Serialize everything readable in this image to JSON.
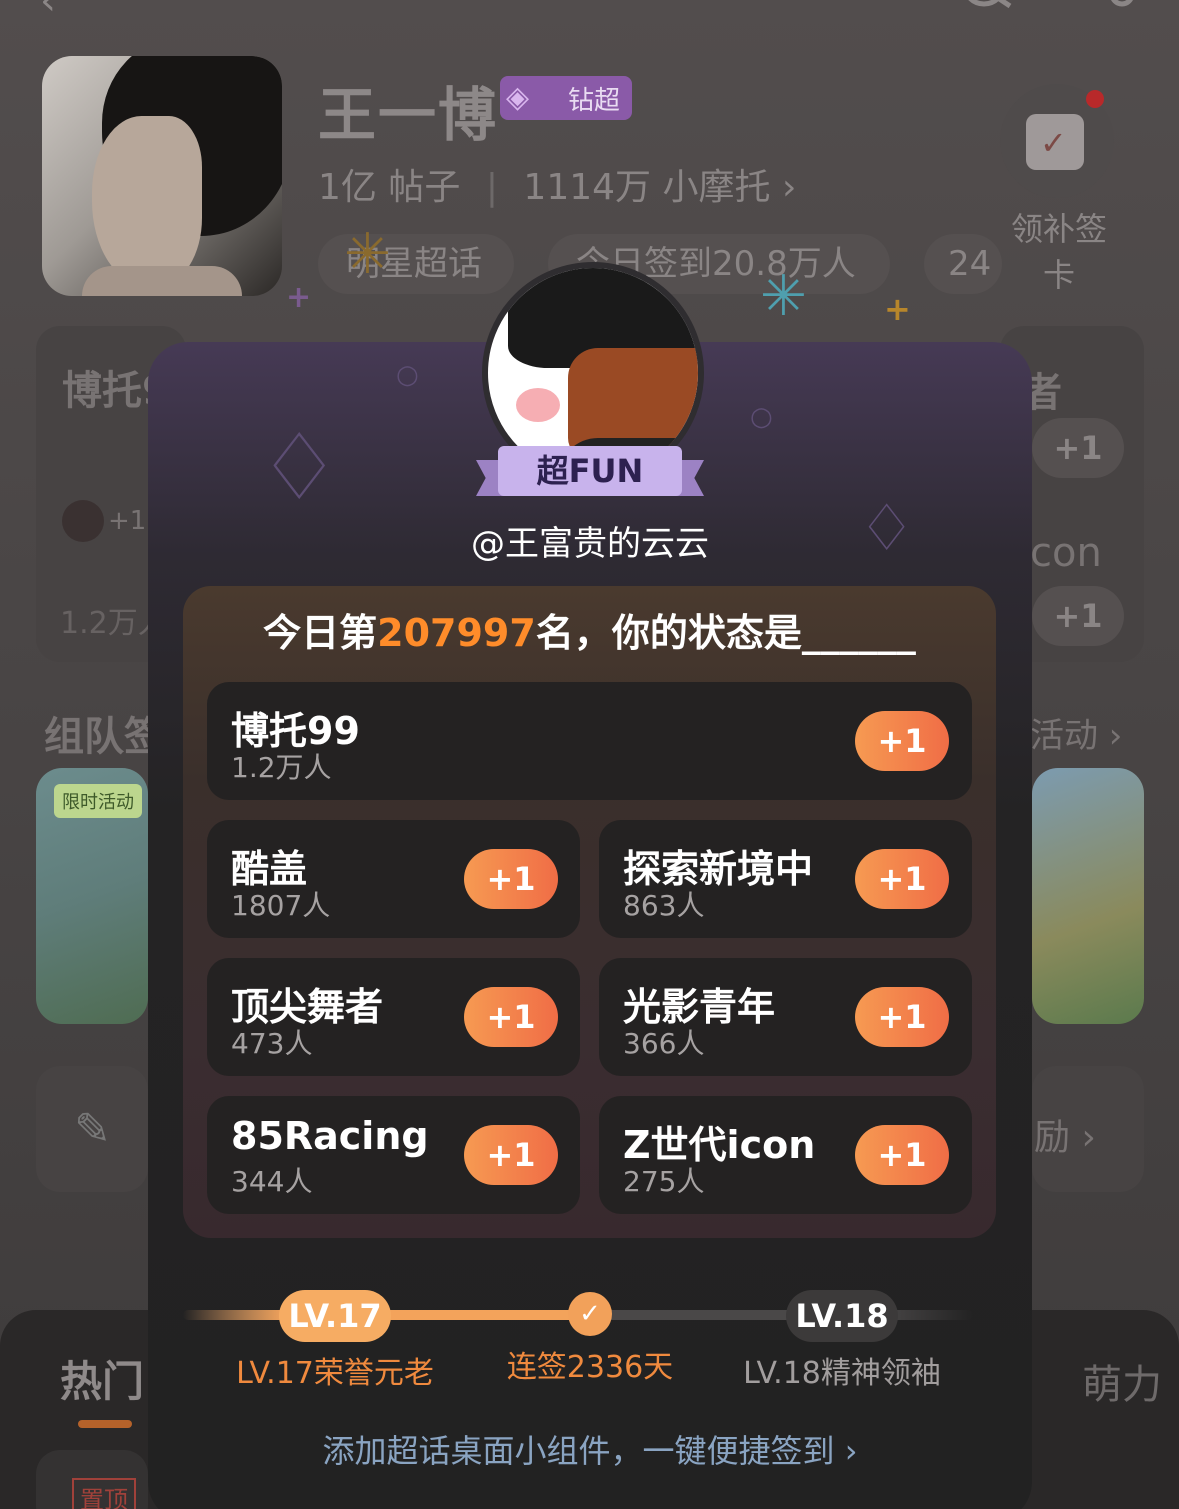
{
  "background": {
    "star": {
      "name": "王一博",
      "badge": "钻超",
      "posts_count": "1亿",
      "posts_label": "帖子",
      "fans_count": "1114万",
      "fans_label": "小摩托",
      "category": "明星超话",
      "checkin_today": "今日签到20.8万人",
      "rank_partial": "24"
    },
    "makeup_checkin": "领补签卡",
    "left_card": {
      "title": "博托9",
      "count": "1.2万人",
      "plus": "+1"
    },
    "right_items": [
      {
        "title": "者",
        "plus": "+1"
      },
      {
        "title": "con",
        "plus": "+1"
      }
    ],
    "team_section": {
      "title": "组队签",
      "more": "活动",
      "tile_tag": "限时活动"
    },
    "post_row": {
      "right": "励"
    },
    "tabs": {
      "hot": "热门",
      "right": "萌力"
    },
    "pinned": "置顶"
  },
  "modal": {
    "badge": "超FUN",
    "username": "@王富贵的云云",
    "rank_prefix": "今日第",
    "rank_number": "207997",
    "rank_suffix": "名，你的状态是______",
    "groups": [
      {
        "name": "博托99",
        "count": "1.2万人",
        "action": "+1"
      },
      {
        "name": "酷盖",
        "count": "1807人",
        "action": "+1"
      },
      {
        "name": "探索新境中",
        "count": "863人",
        "action": "+1"
      },
      {
        "name": "顶尖舞者",
        "count": "473人",
        "action": "+1"
      },
      {
        "name": "光影青年",
        "count": "366人",
        "action": "+1"
      },
      {
        "name": "85Racing",
        "count": "344人",
        "action": "+1"
      },
      {
        "name": "Z世代icon",
        "count": "275人",
        "action": "+1"
      }
    ],
    "level": {
      "current": "LV.17",
      "current_title": "LV.17荣誉元老",
      "streak": "连签2336天",
      "next": "LV.18",
      "next_title": "LV.18精神领袖",
      "progress_to_next": 0.5
    },
    "widget_link": "添加超话桌面小组件，一键便捷签到",
    "widget_arrow": "›"
  },
  "colors": {
    "accent_orange": "#f08a3e",
    "badge_purple": "#c8b3ec",
    "link_blue": "#8aa4c2"
  }
}
